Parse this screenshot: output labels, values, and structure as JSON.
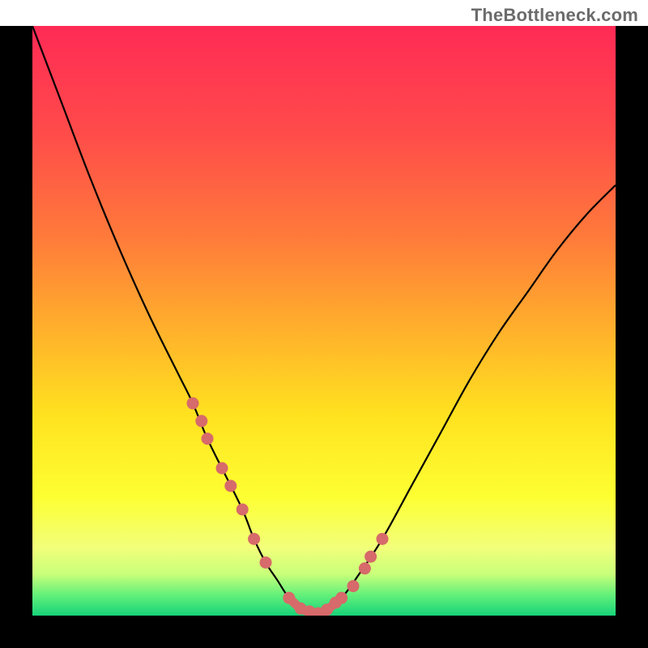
{
  "watermark": "TheBottleneck.com",
  "chart_data": {
    "type": "line",
    "title": "",
    "xlabel": "",
    "ylabel": "",
    "xlim": [
      0,
      100
    ],
    "ylim": [
      0,
      100
    ],
    "grid": false,
    "legend": false,
    "series": [
      {
        "name": "bottleneck-curve",
        "x": [
          0,
          5,
          10,
          15,
          20,
          25,
          27.5,
          30,
          33,
          36,
          38,
          40,
          42,
          44,
          46,
          48,
          50,
          53,
          56,
          60,
          65,
          70,
          75,
          80,
          85,
          90,
          95,
          100
        ],
        "y": [
          100,
          87,
          74,
          62,
          51,
          41,
          36,
          30,
          24,
          18,
          13,
          9,
          6,
          3,
          1.2,
          0.3,
          0.8,
          3,
          7,
          13,
          22,
          31,
          40,
          48,
          55,
          62,
          68,
          73
        ]
      }
    ],
    "markers": {
      "name": "highlighted-points",
      "color": "#d76a6a",
      "x": [
        27.5,
        29,
        30,
        32.5,
        34,
        36,
        38,
        40,
        44,
        46,
        47.5,
        49,
        50.5,
        52,
        53,
        55,
        57,
        58,
        60
      ],
      "y": [
        36,
        33,
        30,
        25,
        22,
        18,
        13,
        9,
        3,
        1.2,
        0.7,
        0.4,
        1,
        2.2,
        3,
        5,
        8,
        10,
        13
      ]
    },
    "connector": {
      "name": "low-band",
      "color": "#d76a6a",
      "x": [
        44,
        46,
        47.5,
        49,
        50.5,
        52
      ],
      "y": [
        3,
        1.2,
        0.7,
        0.4,
        1,
        2.2
      ]
    },
    "gradient_stops": [
      {
        "pos": 0.0,
        "color": "#ff2a55"
      },
      {
        "pos": 0.18,
        "color": "#ff4b4a"
      },
      {
        "pos": 0.36,
        "color": "#ff7b3a"
      },
      {
        "pos": 0.52,
        "color": "#ffb22b"
      },
      {
        "pos": 0.66,
        "color": "#ffe21f"
      },
      {
        "pos": 0.8,
        "color": "#fdff33"
      },
      {
        "pos": 0.885,
        "color": "#f2ff7a"
      },
      {
        "pos": 0.93,
        "color": "#c8ff7a"
      },
      {
        "pos": 0.965,
        "color": "#63f07a"
      },
      {
        "pos": 1.0,
        "color": "#17d37a"
      }
    ]
  }
}
